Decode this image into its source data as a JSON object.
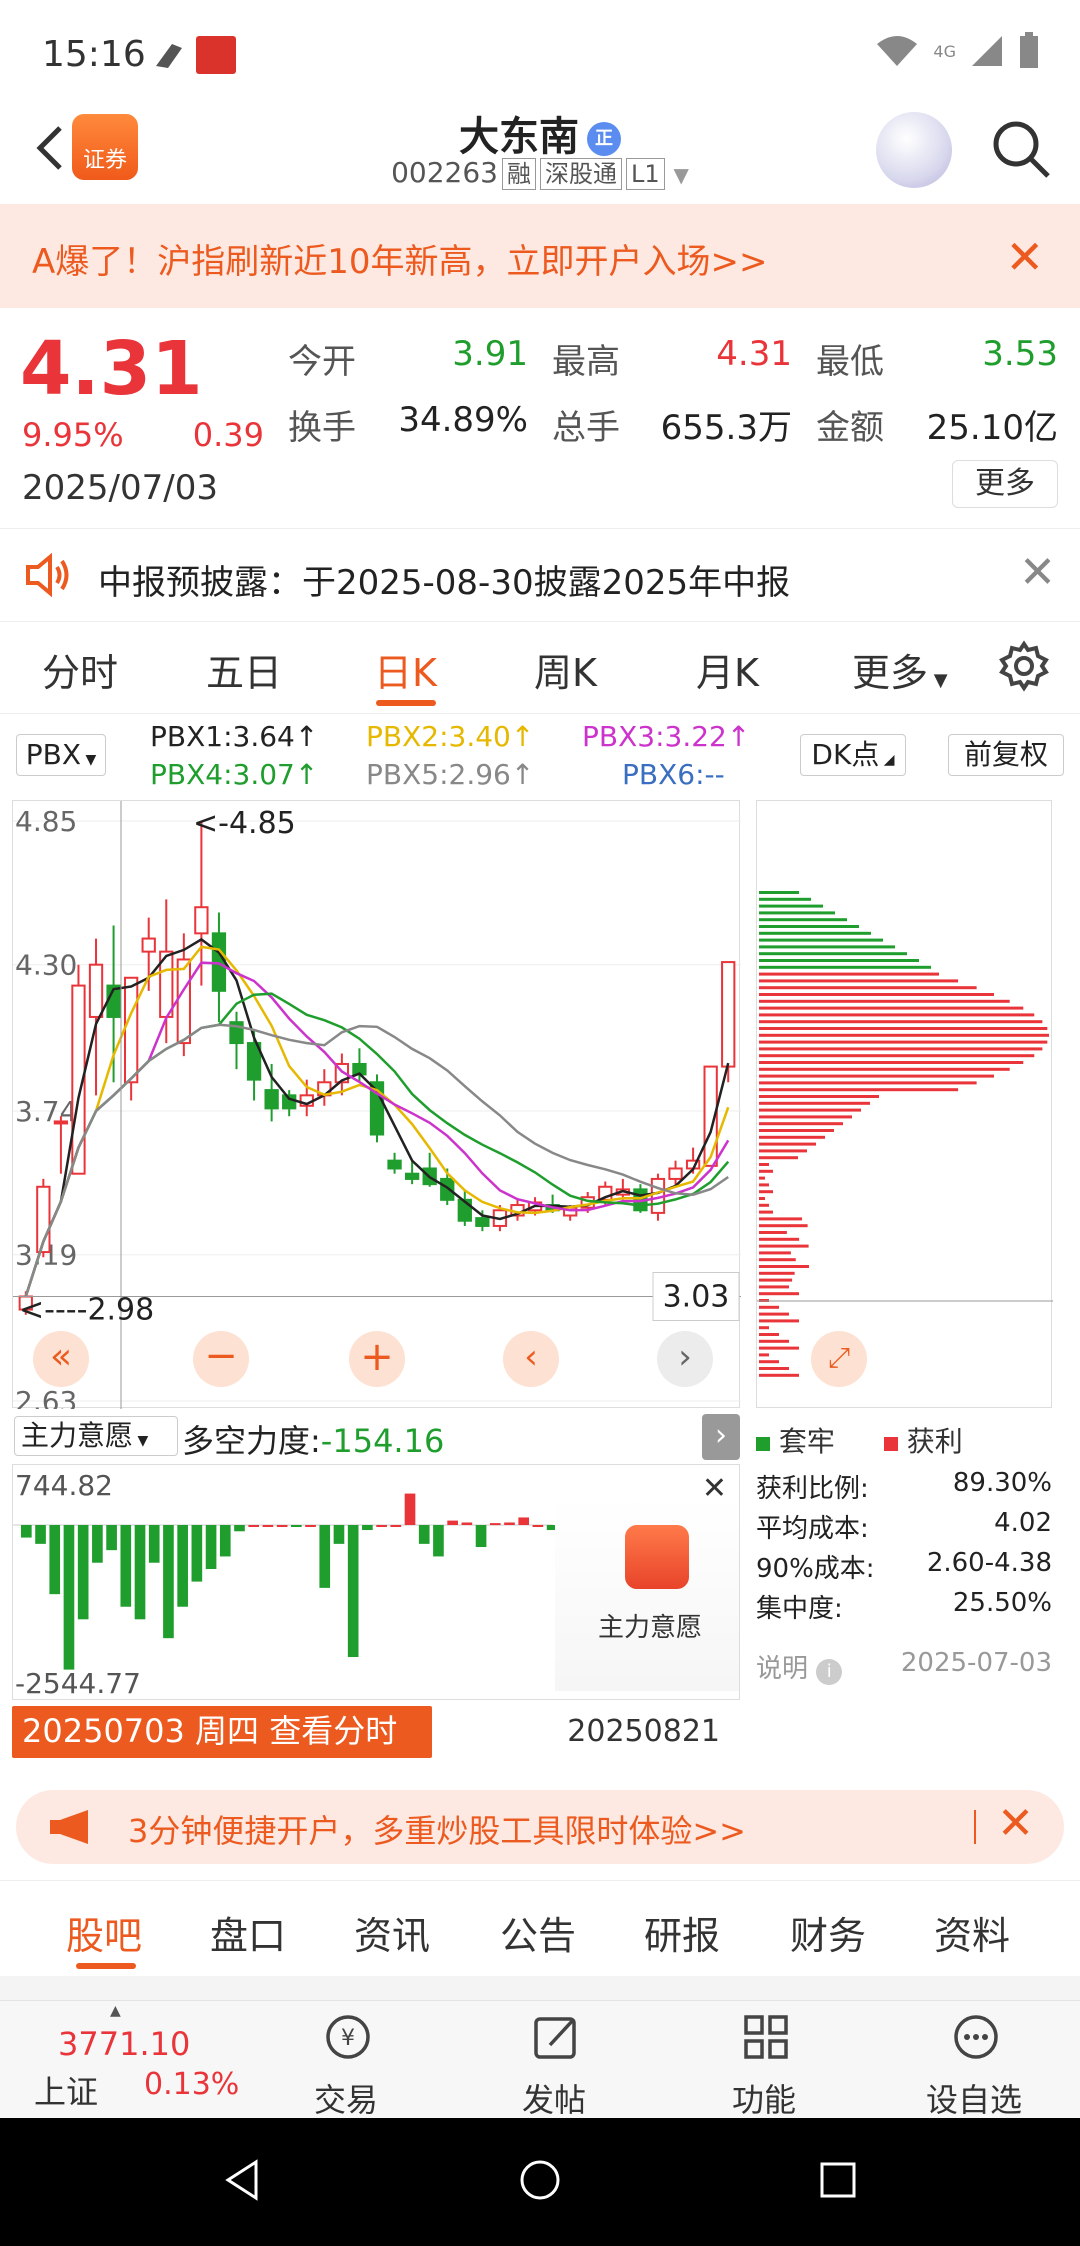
{
  "status": {
    "time": "15:16",
    "network": "4G"
  },
  "header": {
    "brand": "证券",
    "title": "大东南",
    "title_badge": "正",
    "code": "002263",
    "tag_margin": "融",
    "tag_connect": "深股通",
    "tag_level": "L1"
  },
  "promo_top": {
    "text": "A爆了！沪指刷新近10年新高，立即开户入场>>"
  },
  "quote": {
    "price": "4.31",
    "change_pct": "9.95%",
    "change": "0.39",
    "date": "2025/07/03",
    "open_label": "今开",
    "open": "3.91",
    "high_label": "最高",
    "high": "4.31",
    "low_label": "最低",
    "low": "3.53",
    "turnover_label": "换手",
    "turnover": "34.89%",
    "volume_label": "总手",
    "volume": "655.3万",
    "amount_label": "金额",
    "amount": "25.10亿",
    "more": "更多"
  },
  "notice": {
    "text": "中报预披露：于2025-08-30披露2025年中报"
  },
  "tabs": [
    "分时",
    "五日",
    "日K",
    "周K",
    "月K",
    "更多"
  ],
  "active_tab": "日K",
  "ma": {
    "selector": "PBX",
    "pbx1": "PBX1:3.64↑",
    "pbx2": "PBX2:3.40↑",
    "pbx3": "PBX3:3.22↑",
    "pbx4": "PBX4:3.07↑",
    "pbx5": "PBX5:2.96↑",
    "pbx6": "PBX6:--",
    "dk": "DK点",
    "adjust": "前复权",
    "colors": {
      "pbx1": "#222222",
      "pbx2": "#e6b800",
      "pbx3": "#cc33cc",
      "pbx4": "#1f9e2e",
      "pbx5": "#888888",
      "pbx6": "#3a6ec0"
    }
  },
  "chart": {
    "y_labels": [
      "4.85",
      "4.30",
      "3.74",
      "3.19",
      "2.63"
    ],
    "high_marker": "<-4.85",
    "low_marker": "<----2.98",
    "cursor_price": "3.03"
  },
  "chart_data": {
    "type": "candlestick",
    "ylim": [
      2.63,
      4.85
    ],
    "candles": [
      {
        "o": 2.98,
        "h": 3.05,
        "l": 2.96,
        "c": 3.03
      },
      {
        "o": 3.2,
        "h": 3.48,
        "l": 3.18,
        "c": 3.45
      },
      {
        "o": 3.7,
        "h": 3.72,
        "l": 3.5,
        "c": 3.7
      },
      {
        "o": 3.5,
        "h": 4.3,
        "l": 3.5,
        "c": 4.22
      },
      {
        "o": 4.1,
        "h": 4.4,
        "l": 3.8,
        "c": 4.3
      },
      {
        "o": 4.22,
        "h": 4.45,
        "l": 3.85,
        "c": 4.1
      },
      {
        "o": 3.85,
        "h": 4.25,
        "l": 3.78,
        "c": 4.25
      },
      {
        "o": 4.35,
        "h": 4.48,
        "l": 4.2,
        "c": 4.4
      },
      {
        "o": 4.1,
        "h": 4.55,
        "l": 4.0,
        "c": 4.35
      },
      {
        "o": 4.0,
        "h": 4.42,
        "l": 3.95,
        "c": 4.32
      },
      {
        "o": 4.42,
        "h": 4.85,
        "l": 4.22,
        "c": 4.52
      },
      {
        "o": 4.42,
        "h": 4.5,
        "l": 4.08,
        "c": 4.2
      },
      {
        "o": 4.08,
        "h": 4.12,
        "l": 3.9,
        "c": 4.0
      },
      {
        "o": 4.0,
        "h": 4.05,
        "l": 3.78,
        "c": 3.86
      },
      {
        "o": 3.82,
        "h": 3.92,
        "l": 3.7,
        "c": 3.75
      },
      {
        "o": 3.8,
        "h": 3.82,
        "l": 3.72,
        "c": 3.75
      },
      {
        "o": 3.76,
        "h": 3.86,
        "l": 3.72,
        "c": 3.8
      },
      {
        "o": 3.8,
        "h": 3.9,
        "l": 3.76,
        "c": 3.85
      },
      {
        "o": 3.85,
        "h": 3.96,
        "l": 3.8,
        "c": 3.92
      },
      {
        "o": 3.92,
        "h": 3.98,
        "l": 3.85,
        "c": 3.88
      },
      {
        "o": 3.85,
        "h": 3.88,
        "l": 3.62,
        "c": 3.65
      },
      {
        "o": 3.55,
        "h": 3.58,
        "l": 3.5,
        "c": 3.52
      },
      {
        "o": 3.5,
        "h": 3.55,
        "l": 3.46,
        "c": 3.48
      },
      {
        "o": 3.52,
        "h": 3.58,
        "l": 3.45,
        "c": 3.46
      },
      {
        "o": 3.48,
        "h": 3.52,
        "l": 3.38,
        "c": 3.4
      },
      {
        "o": 3.4,
        "h": 3.44,
        "l": 3.3,
        "c": 3.32
      },
      {
        "o": 3.33,
        "h": 3.36,
        "l": 3.28,
        "c": 3.3
      },
      {
        "o": 3.3,
        "h": 3.38,
        "l": 3.28,
        "c": 3.36
      },
      {
        "o": 3.34,
        "h": 3.4,
        "l": 3.32,
        "c": 3.38
      },
      {
        "o": 3.36,
        "h": 3.41,
        "l": 3.34,
        "c": 3.39
      },
      {
        "o": 3.38,
        "h": 3.42,
        "l": 3.35,
        "c": 3.36
      },
      {
        "o": 3.34,
        "h": 3.38,
        "l": 3.32,
        "c": 3.37
      },
      {
        "o": 3.37,
        "h": 3.43,
        "l": 3.35,
        "c": 3.41
      },
      {
        "o": 3.4,
        "h": 3.47,
        "l": 3.38,
        "c": 3.45
      },
      {
        "o": 3.42,
        "h": 3.48,
        "l": 3.4,
        "c": 3.44
      },
      {
        "o": 3.44,
        "h": 3.46,
        "l": 3.35,
        "c": 3.36
      },
      {
        "o": 3.35,
        "h": 3.5,
        "l": 3.32,
        "c": 3.48
      },
      {
        "o": 3.48,
        "h": 3.55,
        "l": 3.45,
        "c": 3.52
      },
      {
        "o": 3.52,
        "h": 3.6,
        "l": 3.5,
        "c": 3.55
      },
      {
        "o": 3.53,
        "h": 3.72,
        "l": 3.53,
        "c": 3.91
      },
      {
        "o": 3.91,
        "h": 4.31,
        "l": 3.85,
        "c": 4.31
      }
    ]
  },
  "indicator": {
    "selector": "主力意愿",
    "text_label": "多空力度:",
    "text_value": "-154.16",
    "max": "744.82",
    "min": "-2544.77",
    "overlay_label": "主力意愿"
  },
  "date_bar": {
    "left": "20250703 周四 查看分时 >",
    "right": "20250821"
  },
  "chips": {
    "legend_trapped": "套牢",
    "legend_profit": "获利",
    "rows": [
      {
        "label": "获利比例:",
        "value": "89.30%"
      },
      {
        "label": "平均成本:",
        "value": "4.02"
      },
      {
        "label": "90%成本:",
        "value": "2.60-4.38"
      },
      {
        "label": "集中度:",
        "value": "25.50%"
      }
    ],
    "explain": "说明",
    "date": "2025-07-03"
  },
  "promo_bottom": {
    "text": "3分钟便捷开户，多重炒股工具限时体验>>"
  },
  "bottom_tabs": [
    "股吧",
    "盘口",
    "资讯",
    "公告",
    "研报",
    "财务",
    "资料"
  ],
  "bottom_nav": {
    "index_value": "3771.10",
    "index_name": "上证",
    "index_change": "0.13%",
    "items": [
      "交易",
      "发帖",
      "功能",
      "设自选"
    ]
  }
}
